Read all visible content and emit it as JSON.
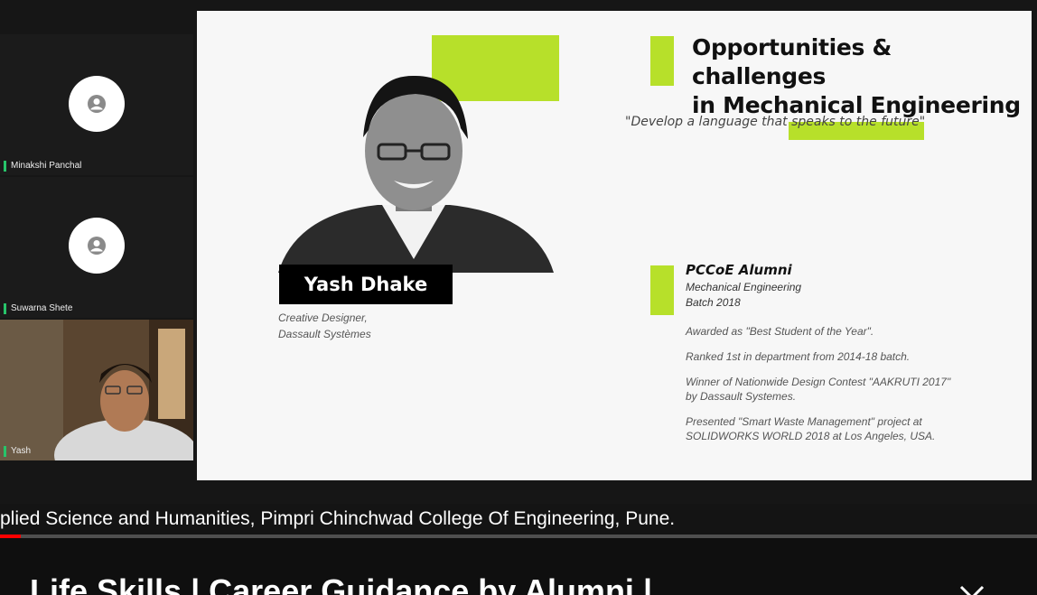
{
  "participants": [
    {
      "name": "Minakshi Panchal",
      "avatar_icon": "person-icon"
    },
    {
      "name": "Suwarna Shete",
      "avatar_icon": "person-icon"
    },
    {
      "name": "Yash"
    }
  ],
  "slide": {
    "title_line1": "Opportunities & challenges",
    "title_line2": "in Mechanical Engineering",
    "quote": "\"Develop a language that speaks to the future\"",
    "speaker_name": "Yash Dhake",
    "speaker_role_line1": "Creative Designer,",
    "speaker_role_line2": "Dassault Systèmes",
    "alumni_heading": "PCCoE Alumni",
    "alumni_dept": "Mechanical Engineering",
    "alumni_batch": "Batch 2018",
    "achievements": [
      "Awarded as \"Best Student of the Year\".",
      "Ranked 1st in department from 2014-18 batch.",
      "Winner of Nationwide Design Contest \"AAKRUTI 2017\" by Dassault Systemes.",
      "Presented \"Smart Waste Management\" project at SOLIDWORKS WORLD 2018 at Los Angeles, USA."
    ],
    "accent_color": "#b7e02a"
  },
  "caption": "plied Science and Humanities, Pimpri Chinchwad College Of Engineering, Pune.",
  "progress": 0.02,
  "video_title": "Life Skills | Career Guidance by Alumni |",
  "colors": {
    "progress": "#ff0000",
    "speaker_indicator": "#27c46a"
  }
}
